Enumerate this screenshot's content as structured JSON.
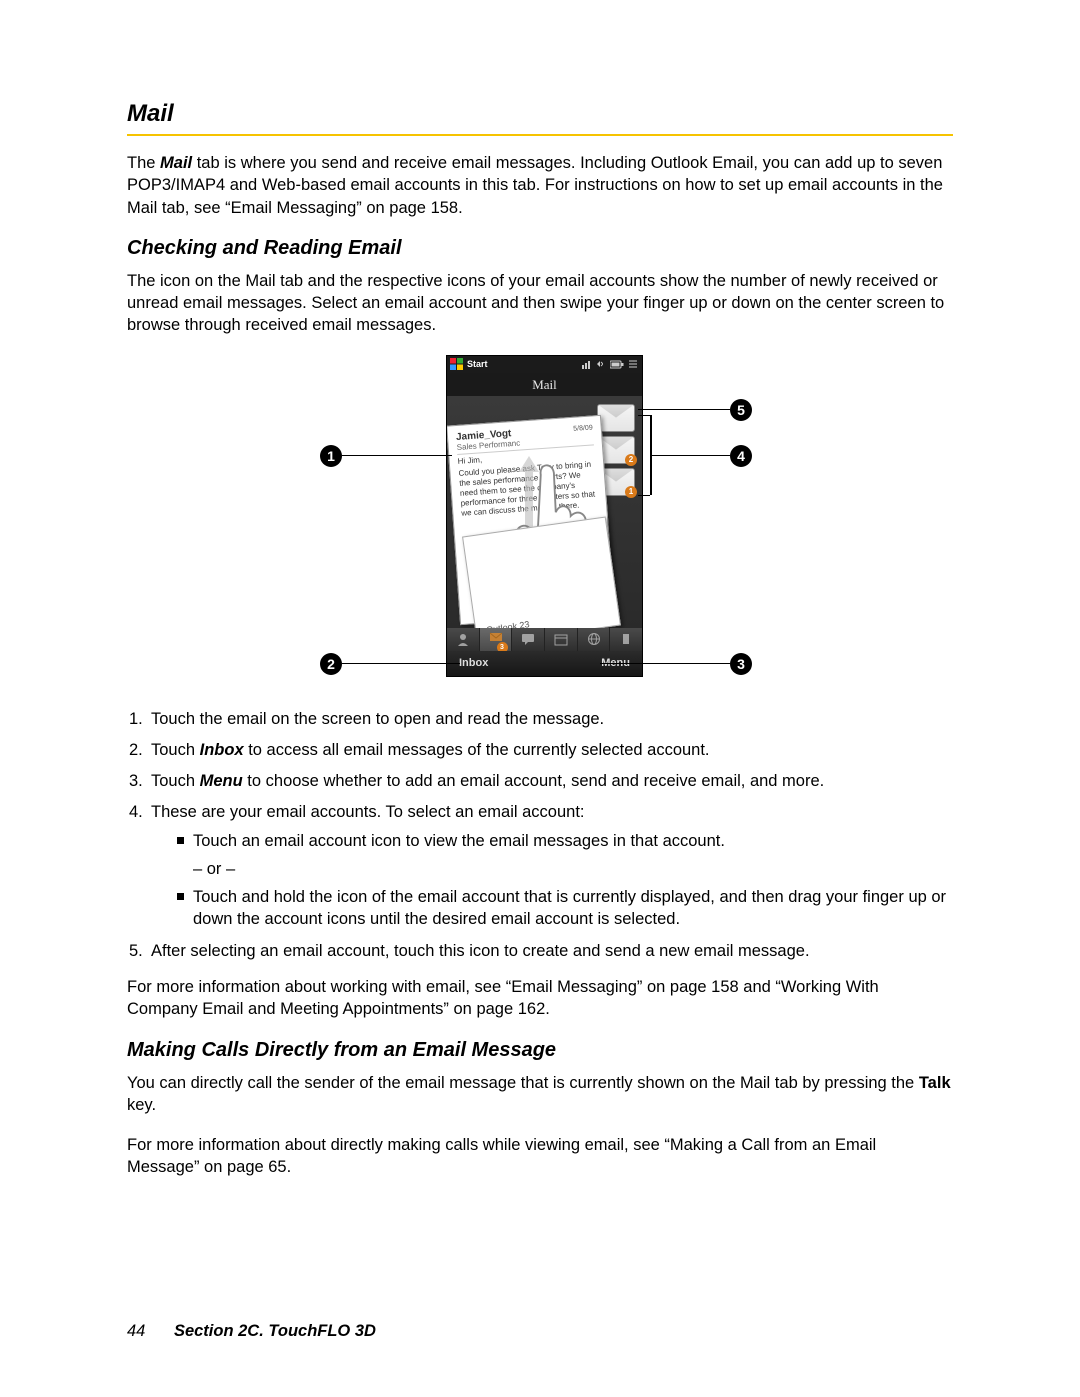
{
  "headings": {
    "mail": "Mail",
    "checking": "Checking and Reading Email",
    "making_calls": "Making Calls Directly from an Email Message"
  },
  "paragraphs": {
    "mail_intro_pre": "The ",
    "mail_intro_bold": "Mail",
    "mail_intro_post": " tab is where you send and receive email messages. Including Outlook Email, you can add up to seven POP3/IMAP4 and Web-based email accounts in this tab. For instructions on how to set up email accounts in the Mail tab, see “Email Messaging” on page 158.",
    "checking_intro": "The icon on the Mail tab and the respective icons of your email accounts show the number of newly received or unread email messages. Select an email account and then swipe your finger up or down on the center screen to browse through received email messages.",
    "more_info_email": "For more information about working with email, see “Email Messaging” on page 158 and “Working With Company Email and Meeting Appointments” on page 162.",
    "calls_intro_pre": "You can directly call the sender of the email message that is currently shown on the Mail tab by pressing the ",
    "calls_intro_bold": "Talk",
    "calls_intro_post": " key.",
    "calls_more": "For more information about directly making calls while viewing email, see “Making a Call from an Email Message” on page 65."
  },
  "list": {
    "i1": "Touch the email on the screen to open and read the message.",
    "i2_pre": "Touch ",
    "i2_bold": "Inbox",
    "i2_post": " to access all email messages of the currently selected account.",
    "i3_pre": "Touch ",
    "i3_bold": "Menu",
    "i3_post": " to choose whether to add an email account, send and receive email, and more.",
    "i4": "These are your email accounts. To select an email account:",
    "i4a": "Touch an email account icon to view the email messages in that account.",
    "i4or": "– or –",
    "i4b": "Touch and hold the icon of the email account that is currently displayed, and then drag your finger up or down the account icons until the desired email account is selected.",
    "i5": "After selecting an email account, touch this icon to create and send a new email message."
  },
  "nums": {
    "n1": "1.",
    "n2": "2.",
    "n3": "3.",
    "n4": "4.",
    "n5": "5."
  },
  "callouts": {
    "c1": "1",
    "c2": "2",
    "c3": "3",
    "c4": "4",
    "c5": "5"
  },
  "phone": {
    "start": "Start",
    "title": "Mail",
    "from": "Jamie_Vogt",
    "date": "5/8/09",
    "subject": "Sales Performanc",
    "greeting": "Hi Jim,",
    "body": "Could you please ask Tony to bring in the sales performance charts? We need them to see the company's performance for three quarters so that we can discuss the metrics there.",
    "outlook": "Outlook 23",
    "inbox": "Inbox",
    "menu": "Menu",
    "badge_mid": "2",
    "badge_front": "1",
    "tab_badge": "3"
  },
  "footer": {
    "page": "44",
    "section": "Section 2C. TouchFLO 3D"
  }
}
